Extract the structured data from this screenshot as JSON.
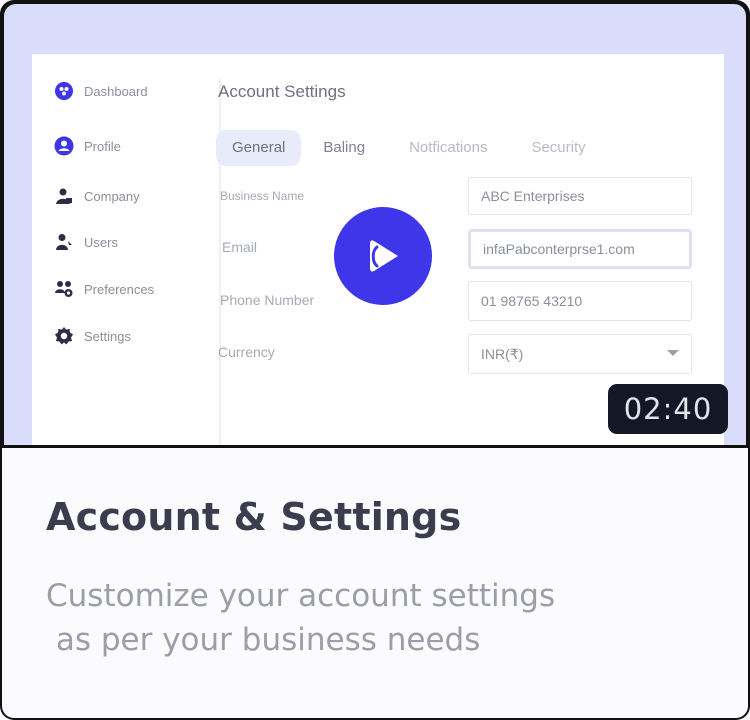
{
  "sidebar": {
    "items": [
      {
        "label": "Dashboard",
        "icon": "dashboard-icon"
      },
      {
        "label": "Profile",
        "icon": "profile-icon"
      },
      {
        "label": "Company",
        "icon": "company-icon"
      },
      {
        "label": "Users",
        "icon": "users-icon"
      },
      {
        "label": "Preferences",
        "icon": "preferences-icon"
      },
      {
        "label": "Settings",
        "icon": "settings-icon"
      }
    ]
  },
  "main": {
    "title": "Account Settings",
    "tabs": [
      {
        "label": "General"
      },
      {
        "label": "Baling"
      },
      {
        "label": "Notfications"
      },
      {
        "label": "Security"
      }
    ],
    "form": {
      "business_name": {
        "label": "Business Name",
        "value": "ABC Enterprises"
      },
      "email": {
        "label": "Email",
        "value": "infaPabconterprse1.com"
      },
      "phone": {
        "label": "Phone Number",
        "value": "01 98765 43210"
      },
      "currency": {
        "label": "Currency",
        "value": "INR(₹)"
      }
    }
  },
  "video": {
    "duration": "02:40",
    "play_icon": "play-icon"
  },
  "caption": {
    "title": "Account & Settings",
    "description": "Customize your account settings\n as per your business needs"
  },
  "colors": {
    "accent": "#3e36e8",
    "thumbnail_bg": "#d9dcfb",
    "duration_badge": "#121826"
  }
}
